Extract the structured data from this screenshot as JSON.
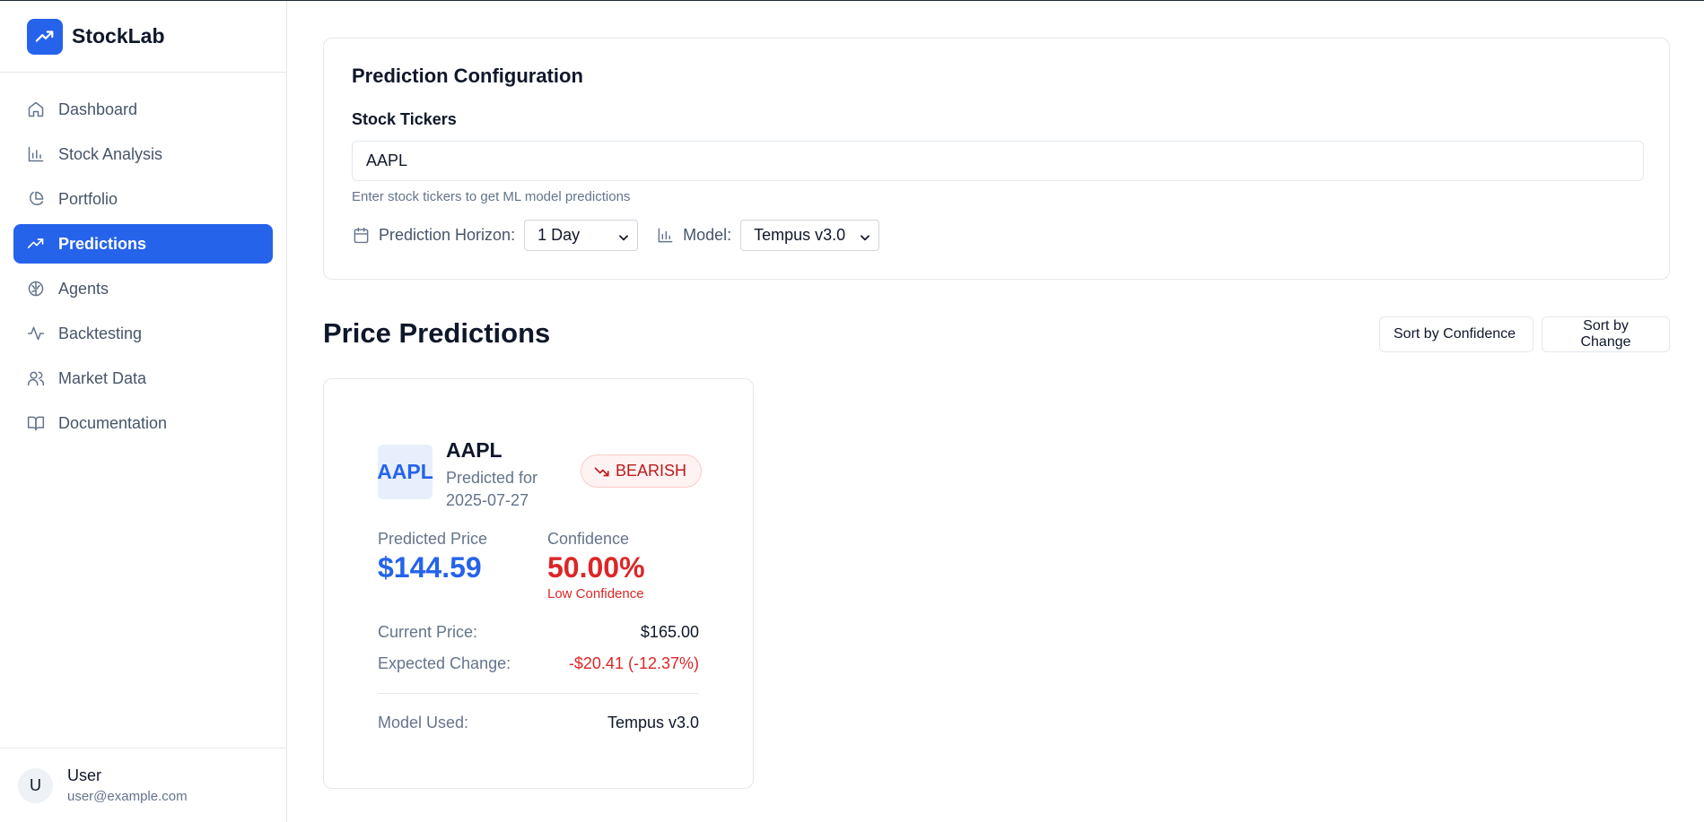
{
  "app": {
    "name": "StockLab"
  },
  "sidebar": {
    "items": [
      {
        "label": "Dashboard",
        "icon": "home-icon"
      },
      {
        "label": "Stock Analysis",
        "icon": "bar-chart-icon"
      },
      {
        "label": "Portfolio",
        "icon": "pie-chart-icon"
      },
      {
        "label": "Predictions",
        "icon": "trending-up-icon",
        "active": true
      },
      {
        "label": "Agents",
        "icon": "brain-icon"
      },
      {
        "label": "Backtesting",
        "icon": "activity-icon"
      },
      {
        "label": "Market Data",
        "icon": "users-icon"
      },
      {
        "label": "Documentation",
        "icon": "book-icon"
      }
    ],
    "user": {
      "initial": "U",
      "name": "User",
      "email": "user@example.com"
    }
  },
  "config": {
    "title": "Prediction Configuration",
    "tickers_label": "Stock Tickers",
    "tickers_value": "AAPL",
    "help": "Enter stock tickers to get ML model predictions",
    "horizon_label": "Prediction Horizon:",
    "horizon_value": "1 Day",
    "model_label": "Model:",
    "model_value": "Tempus v3.0"
  },
  "predictions": {
    "title": "Price Predictions",
    "sort_confidence": "Sort by Confidence",
    "sort_change": "Sort by Change",
    "cards": [
      {
        "ticker": "AAPL",
        "badge": "AAPL",
        "predicted_for": "Predicted for 2025-07-27",
        "trend": "BEARISH",
        "predicted_price_label": "Predicted Price",
        "predicted_price": "$144.59",
        "confidence_label": "Confidence",
        "confidence": "50.00%",
        "confidence_note": "Low Confidence",
        "current_price_label": "Current Price:",
        "current_price": "$165.00",
        "expected_change_label": "Expected Change:",
        "expected_change": "-$20.41 (-12.37%)",
        "model_used_label": "Model Used:",
        "model_used": "Tempus v3.0"
      }
    ]
  },
  "colors": {
    "accent": "#2563eb",
    "negative": "#dc2626",
    "muted": "#64748b"
  }
}
